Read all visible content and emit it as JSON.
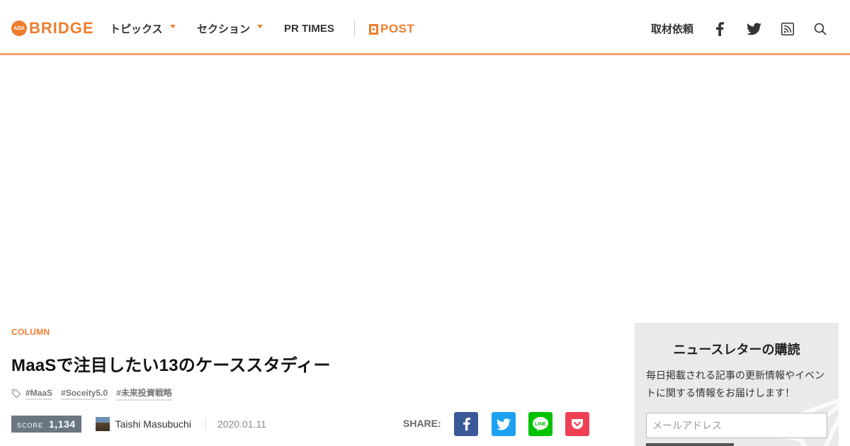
{
  "header": {
    "logo_mark": "AZIA",
    "logo_text": "BRIDGE",
    "nav": [
      {
        "label": "トピックス"
      },
      {
        "label": "セクション"
      },
      {
        "label": "PR TIMES"
      }
    ],
    "post_label": "POST",
    "request_label": "取材依頼"
  },
  "article": {
    "category": "COLUMN",
    "title": "MaaSで注目したい13のケーススタディー",
    "tags": [
      "#MaaS",
      "#Soceity5.0",
      "#未来投資戦略"
    ],
    "score_label": "SCORE",
    "score_value": "1,134",
    "author": "Taishi Masubuchi",
    "date": "2020.01.11",
    "share_label": "SHARE:"
  },
  "newsletter": {
    "title": "ニュースレターの購読",
    "description": "毎日掲載される記事の更新情報やイベントに関する情報をお届けします！",
    "email_placeholder": "メールアドレス"
  },
  "colors": {
    "brand_orange": "#ef7d2d",
    "facebook": "#3b5998",
    "twitter": "#1da1f2",
    "line": "#00c300",
    "pocket": "#ef4056"
  }
}
